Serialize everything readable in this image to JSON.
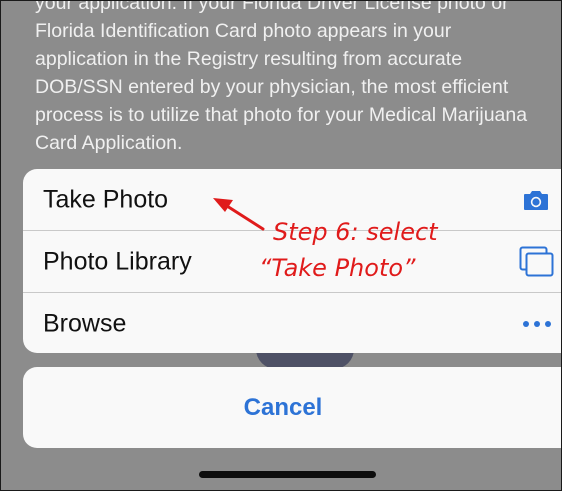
{
  "background": {
    "paragraph_lines": [
      "your application. If your Florida Driver License photo or",
      "Florida Identification Card photo appears in your",
      "application in the Registry resulting from accurate",
      "DOB/SSN entered by your physician, the most efficient",
      "process is to utilize that photo for your Medical Marijuana",
      "Card Application."
    ]
  },
  "action_sheet": {
    "items": [
      {
        "label": "Take Photo",
        "icon": "camera-icon"
      },
      {
        "label": "Photo Library",
        "icon": "photo-library-icon"
      },
      {
        "label": "Browse",
        "icon": "more-icon"
      }
    ],
    "cancel_label": "Cancel"
  },
  "annotation": {
    "line1": "Step 6: select",
    "line2": "“Take Photo”"
  },
  "colors": {
    "accent": "#2d73d6",
    "annotation": "#e01b1b",
    "dim_background": "#8c8c8c",
    "sheet": "#f9f9f9"
  }
}
